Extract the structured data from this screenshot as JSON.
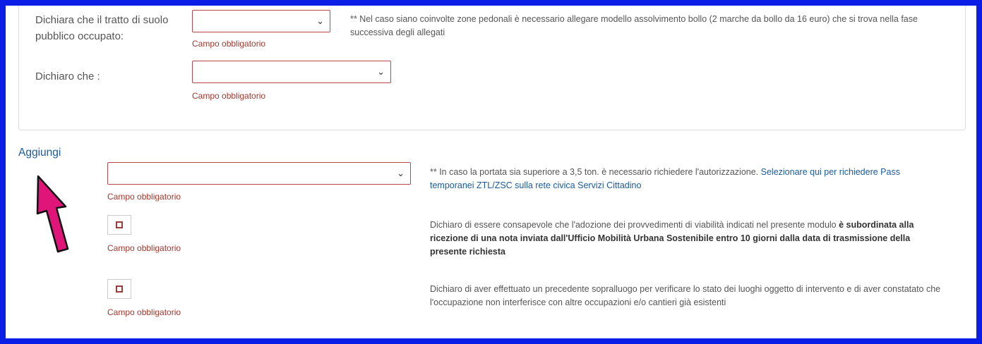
{
  "card": {
    "row1": {
      "label": "Dichiara che il tratto di suolo pubblico occupato:",
      "required": "Campo obbligatorio",
      "note": "** Nel caso siano coinvolte zone pedonali è necessario allegare modello assolvimento bollo (2 marche da bollo da 16 euro) che si trova nella fase successiva degli allegati"
    },
    "row2": {
      "label": "Dichiaro che :",
      "required": "Campo obbligatorio"
    }
  },
  "aggiungi_label": "Aggiungi",
  "section": {
    "select_required": "Campo obbligatorio",
    "note1_text": "** In caso la portata sia superiore a 3,5 ton. è necessario richiedere l'autorizzazione. ",
    "note1_link": "Selezionare qui per richiedere Pass temporanei ZTL/ZSC sulla rete civica Servizi Cittadino",
    "check1_required": "Campo obbligatorio",
    "check1_text": "Dichiaro di essere consapevole che l'adozione dei provvedimenti di viabilità indicati nel presente modulo ",
    "check1_bold": "è subordinata alla ricezione di una nota inviata dall'Ufficio Mobilità Urbana Sostenibile entro 10 giorni dalla data di trasmissione della presente richiesta",
    "check2_required": "Campo obbligatorio",
    "check2_text": "Dichiaro di aver effettuato un precedente sopralluogo per verificare lo stato dei luoghi oggetto di intervento e di aver constatato che l'occupazione non interferisce con altre occupazioni e/o cantieri già esistenti"
  },
  "icons": {
    "chevron": "chevron-down-icon",
    "arrow": "pointer-arrow-icon"
  },
  "colors": {
    "frame": "#0a1ee6",
    "select_border": "#b9474f",
    "required_text": "#a0382d",
    "link": "#1a5a9c",
    "arrow": "#e0157a"
  }
}
